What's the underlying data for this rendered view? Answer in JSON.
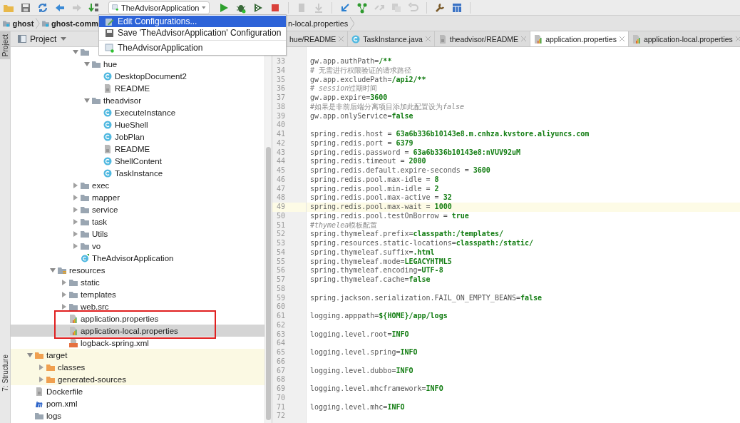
{
  "toolbar": {
    "buttons": [
      {
        "kind": "folder",
        "disabled": false
      },
      {
        "kind": "save",
        "disabled": false
      },
      {
        "kind": "sync",
        "disabled": false
      },
      {
        "kind": "back",
        "disabled": false
      },
      {
        "kind": "forward",
        "disabled": true
      },
      {
        "kind": "sort",
        "disabled": false
      }
    ],
    "run_config": {
      "label": "TheAdvisorApplication"
    },
    "run_buttons": [
      {
        "kind": "run",
        "disabled": false
      },
      {
        "kind": "debug",
        "disabled": false
      },
      {
        "kind": "coverage",
        "disabled": false
      },
      {
        "kind": "stop",
        "disabled": false
      },
      {
        "kind": "build",
        "disabled": true
      },
      {
        "kind": "download",
        "disabled": true
      },
      {
        "kind": "update",
        "disabled": false
      },
      {
        "kind": "commit",
        "disabled": false
      },
      {
        "kind": "compare",
        "disabled": true
      },
      {
        "kind": "copy",
        "disabled": true
      },
      {
        "kind": "undo",
        "disabled": true
      },
      {
        "kind": "settings",
        "disabled": false
      },
      {
        "kind": "structure",
        "disabled": false
      }
    ]
  },
  "run_menu": {
    "items": [
      {
        "kind": "edit",
        "label": "Edit Configurations...",
        "selected": true
      },
      {
        "kind": "save",
        "label": "Save 'TheAdvisorApplication' Configuration",
        "selected": false
      },
      {
        "kind": "separator"
      },
      {
        "kind": "configuration",
        "label": "TheAdvisorApplication",
        "selected": false
      }
    ]
  },
  "breadcrumbs": [
    {
      "label": "ghost"
    },
    {
      "label": "ghost-comm"
    },
    {
      "label": "n-local.properties"
    }
  ],
  "tool_strip": [
    {
      "label": "Project",
      "selected": true
    },
    {
      "label": "7: Structure",
      "selected": false
    }
  ],
  "project_panel": {
    "title": "Project",
    "tree": [
      {
        "children": [
          {
            "children": [
              {
                "children": [
                  {
                    "children": [
                      {
                        "kind": "folder",
                        "expanded": true,
                        "selected": false,
                        "children": [
                          {
                            "kind": "folder",
                            "label": "hue",
                            "expanded": true,
                            "selected": false,
                            "children": [
                              {
                                "kind": "class",
                                "label": "DesktopDocument2",
                                "selected": false
                              },
                              {
                                "kind": "file",
                                "label": "README",
                                "selected": false
                              }
                            ]
                          },
                          {
                            "kind": "folder",
                            "label": "theadvisor",
                            "expanded": true,
                            "selected": false,
                            "children": [
                              {
                                "kind": "class",
                                "label": "ExecuteInstance",
                                "selected": false
                              },
                              {
                                "kind": "class",
                                "label": "HueShell",
                                "selected": false
                              },
                              {
                                "kind": "class",
                                "label": "JobPlan",
                                "selected": false
                              },
                              {
                                "kind": "file",
                                "label": "README",
                                "selected": false
                              },
                              {
                                "kind": "class",
                                "label": "ShellContent",
                                "selected": false
                              },
                              {
                                "kind": "class",
                                "label": "TaskInstance",
                                "selected": false
                              }
                            ]
                          }
                        ]
                      },
                      {
                        "kind": "folder",
                        "label": "exec",
                        "expanded": false,
                        "selected": false
                      },
                      {
                        "kind": "folder",
                        "label": "mapper",
                        "expanded": false,
                        "selected": false
                      },
                      {
                        "kind": "folder",
                        "label": "service",
                        "expanded": false,
                        "selected": false
                      },
                      {
                        "kind": "folder",
                        "label": "task",
                        "expanded": false,
                        "selected": false
                      },
                      {
                        "kind": "folder",
                        "label": "Utils",
                        "expanded": false,
                        "selected": false
                      },
                      {
                        "kind": "folder",
                        "label": "vo",
                        "expanded": false,
                        "selected": false
                      },
                      {
                        "kind": "spring-class",
                        "label": "TheAdvisorApplication",
                        "selected": false
                      }
                    ]
                  }
                ]
              },
              {
                "kind": "resources-folder",
                "label": "resources",
                "expanded": true,
                "selected": false,
                "children": [
                  {
                    "kind": "folder",
                    "label": "static",
                    "expanded": false,
                    "selected": false
                  },
                  {
                    "kind": "folder",
                    "label": "templates",
                    "expanded": false,
                    "selected": false
                  },
                  {
                    "kind": "folder",
                    "label": "web.src",
                    "expanded": false,
                    "selected": false
                  },
                  {
                    "kind": "properties",
                    "label": "application.properties",
                    "selected": false,
                    "marked": true
                  },
                  {
                    "kind": "properties",
                    "label": "application-local.properties",
                    "selected": true,
                    "marked": true
                  },
                  {
                    "kind": "xml",
                    "label": "logback-spring.xml",
                    "selected": false
                  }
                ]
              }
            ]
          }
        ]
      },
      {
        "kind": "excluded-folder",
        "label": "target",
        "expanded": true,
        "selected": false,
        "children": [
          {
            "kind": "excluded-folder",
            "label": "classes",
            "expanded": false,
            "selected": false
          },
          {
            "kind": "excluded-folder",
            "label": "generated-sources",
            "expanded": false,
            "selected": false
          }
        ]
      },
      {
        "kind": "file",
        "label": "Dockerfile",
        "selected": false
      },
      {
        "kind": "maven",
        "label": "pom.xml",
        "selected": false
      },
      {
        "kind": "folder",
        "label": "logs",
        "selected": false
      }
    ]
  },
  "editor": {
    "tabs": [
      {
        "label": "hue/README",
        "selected": false
      },
      {
        "kind": "class",
        "label": "TaskInstance.java",
        "selected": false
      },
      {
        "kind": "file",
        "label": "theadvisor/README",
        "selected": false
      },
      {
        "kind": "properties",
        "label": "application.properties",
        "selected": true
      },
      {
        "kind": "properties",
        "label": "application-local.properties",
        "selected": false
      }
    ],
    "lines": [
      {
        "number": "33",
        "kind": "property",
        "key": "gw.app.authPath",
        "separator": "=",
        "value": "/**",
        "current": false
      },
      {
        "number": "34",
        "kind": "comment",
        "parts": [
          {
            "text": "# 无需进行权限验证的请求路径"
          }
        ],
        "current": false
      },
      {
        "number": "35",
        "kind": "property",
        "key": "gw.app.excludePath",
        "separator": "=",
        "value": "/api2/**",
        "current": false
      },
      {
        "number": "36",
        "kind": "comment",
        "parts": [
          {
            "text": "# "
          },
          {
            "text": "session",
            "italic": true
          },
          {
            "text": "过期时间"
          }
        ],
        "current": false
      },
      {
        "number": "37",
        "kind": "property",
        "key": "gw.app.expire",
        "separator": "=",
        "value": "3600",
        "current": false
      },
      {
        "number": "38",
        "kind": "comment",
        "parts": [
          {
            "text": "#如果是非前后端分离项目添加此配置设为"
          },
          {
            "text": "false",
            "italic": true
          }
        ],
        "current": false
      },
      {
        "number": "39",
        "kind": "property",
        "key": "gw.app.onlyService",
        "separator": "=",
        "value": "false",
        "current": false
      },
      {
        "number": "40",
        "kind": "blank",
        "current": false
      },
      {
        "number": "41",
        "kind": "property",
        "key": "spring.redis.host",
        "separator": " = ",
        "value": "63a6b336b10143e8.m.cnhza.kvstore.aliyuncs.com",
        "current": false
      },
      {
        "number": "42",
        "kind": "property",
        "key": "spring.redis.port",
        "separator": " = ",
        "value": "6379",
        "current": false
      },
      {
        "number": "43",
        "kind": "property",
        "key": "spring.redis.password",
        "separator": " = ",
        "value": "63a6b336b10143e8:nVUV92uM",
        "current": false
      },
      {
        "number": "44",
        "kind": "property",
        "key": "spring.redis.timeout",
        "separator": " = ",
        "value": "2000",
        "current": false
      },
      {
        "number": "45",
        "kind": "property",
        "key": "spring.redis.default.expire-seconds",
        "separator": " = ",
        "value": "3600",
        "current": false
      },
      {
        "number": "46",
        "kind": "property",
        "key": "spring.redis.pool.max-idle",
        "separator": " = ",
        "value": "8",
        "current": false
      },
      {
        "number": "47",
        "kind": "property",
        "key": "spring.redis.pool.min-idle",
        "separator": " = ",
        "value": "2",
        "current": false
      },
      {
        "number": "48",
        "kind": "property",
        "key": "spring.redis.pool.max-active",
        "separator": " = ",
        "value": "32",
        "current": false
      },
      {
        "number": "49",
        "kind": "property",
        "key": "spring.redis.pool.max-wait",
        "separator": " = ",
        "value": "1000",
        "current": true
      },
      {
        "number": "50",
        "kind": "property",
        "key": "spring.redis.pool.testOnBorrow",
        "separator": " = ",
        "value": "true",
        "current": false
      },
      {
        "number": "51",
        "kind": "comment",
        "parts": [
          {
            "text": "#"
          },
          {
            "text": "thymelea",
            "italic": true
          },
          {
            "text": "模板配置"
          }
        ],
        "current": false
      },
      {
        "number": "52",
        "kind": "property",
        "key": "spring.thymeleaf.prefix",
        "separator": "=",
        "value": "classpath:/templates/",
        "current": false
      },
      {
        "number": "53",
        "kind": "property",
        "key": "spring.resources.static-locations",
        "separator": "=",
        "value": "classpath:/static/",
        "current": false
      },
      {
        "number": "54",
        "kind": "property",
        "key": "spring.thymeleaf.suffix",
        "separator": "=",
        "value": ".html",
        "current": false
      },
      {
        "number": "55",
        "kind": "property",
        "key": "spring.thymeleaf.mode",
        "separator": "=",
        "value": "LEGACYHTML5",
        "current": false
      },
      {
        "number": "56",
        "kind": "property",
        "key": "spring.thymeleaf.encoding",
        "separator": "=",
        "value": "UTF-8",
        "current": false
      },
      {
        "number": "57",
        "kind": "property",
        "key": "spring.thymeleaf.cache",
        "separator": "=",
        "value": "false",
        "current": false
      },
      {
        "number": "58",
        "kind": "blank",
        "current": false
      },
      {
        "number": "59",
        "kind": "property",
        "key": "spring.jackson.serialization.FAIL_ON_EMPTY_BEANS",
        "separator": "=",
        "value": "false",
        "current": false
      },
      {
        "number": "60",
        "kind": "blank",
        "current": false
      },
      {
        "number": "61",
        "kind": "property",
        "key": "logging.apppath",
        "separator": "=",
        "value": "${HOME}/app/logs",
        "current": false
      },
      {
        "number": "62",
        "kind": "blank",
        "current": false
      },
      {
        "number": "63",
        "kind": "property",
        "key": "logging.level.root",
        "separator": "=",
        "value": "INFO",
        "current": false
      },
      {
        "number": "64",
        "kind": "blank",
        "current": false
      },
      {
        "number": "65",
        "kind": "property",
        "key": "logging.level.spring",
        "separator": "=",
        "value": "INFO",
        "current": false
      },
      {
        "number": "66",
        "kind": "blank",
        "current": false
      },
      {
        "number": "67",
        "kind": "property",
        "key": "logging.level.dubbo",
        "separator": "=",
        "value": "INFO",
        "current": false
      },
      {
        "number": "68",
        "kind": "blank",
        "current": false
      },
      {
        "number": "69",
        "kind": "property",
        "key": "logging.level.mhcframework",
        "separator": "=",
        "value": "INFO",
        "current": false
      },
      {
        "number": "70",
        "kind": "blank",
        "current": false
      },
      {
        "number": "71",
        "kind": "property",
        "key": "logging.level.mhc",
        "separator": "=",
        "value": "INFO",
        "current": false
      },
      {
        "number": "72",
        "kind": "blank",
        "current": false
      }
    ]
  }
}
